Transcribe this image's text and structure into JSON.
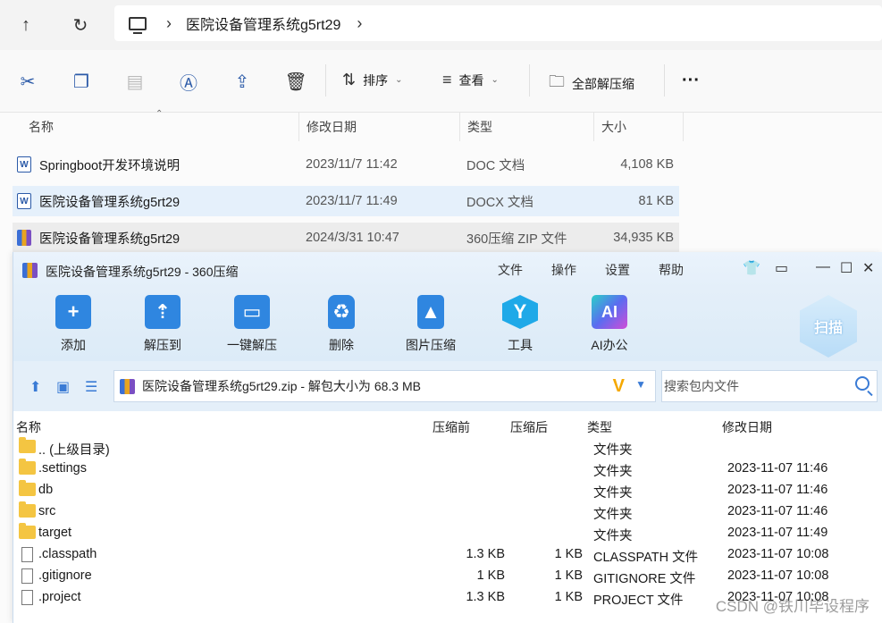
{
  "explorer": {
    "breadcrumb": "医院设备管理系统g5rt29",
    "toolbar": {
      "sort": "排序",
      "view": "查看",
      "extract_all": "全部解压缩"
    },
    "columns": {
      "name": "名称",
      "date": "修改日期",
      "type": "类型",
      "size": "大小"
    },
    "files": [
      {
        "name": "Springboot开发环境说明",
        "date": "2023/11/7 11:42",
        "type": "DOC 文档",
        "size": "4,108 KB",
        "icon": "word-icon"
      },
      {
        "name": "医院设备管理系统g5rt29",
        "date": "2023/11/7 11:49",
        "type": "DOCX 文档",
        "size": "81 KB",
        "icon": "word-icon"
      },
      {
        "name": "医院设备管理系统g5rt29",
        "date": "2024/3/31 10:47",
        "type": "360压缩 ZIP 文件",
        "size": "34,935 KB",
        "icon": "zip-icon"
      }
    ]
  },
  "zip": {
    "title": "医院设备管理系统g5rt29 - 360压缩",
    "menu": [
      "文件",
      "操作",
      "设置",
      "帮助"
    ],
    "tools": [
      "添加",
      "解压到",
      "一键解压",
      "删除",
      "图片压缩",
      "工具",
      "AI办公"
    ],
    "scan": "扫描",
    "path": "医院设备管理系统g5rt29.zip - 解包大小为 68.3 MB",
    "search_placeholder": "搜索包内文件",
    "columns": {
      "name": "名称",
      "compressed_before": "压缩前",
      "compressed_after": "压缩后",
      "type": "类型",
      "date": "修改日期"
    },
    "rows": [
      {
        "name": ".. (上级目录)",
        "before": "",
        "after": "",
        "type": "文件夹",
        "date": "",
        "kind": "folder"
      },
      {
        "name": ".settings",
        "before": "",
        "after": "",
        "type": "文件夹",
        "date": "2023-11-07 11:46",
        "kind": "folder"
      },
      {
        "name": "db",
        "before": "",
        "after": "",
        "type": "文件夹",
        "date": "2023-11-07 11:46",
        "kind": "folder"
      },
      {
        "name": "src",
        "before": "",
        "after": "",
        "type": "文件夹",
        "date": "2023-11-07 11:46",
        "kind": "folder"
      },
      {
        "name": "target",
        "before": "",
        "after": "",
        "type": "文件夹",
        "date": "2023-11-07 11:49",
        "kind": "folder"
      },
      {
        "name": ".classpath",
        "before": "1.3 KB",
        "after": "1 KB",
        "type": "CLASSPATH 文件",
        "date": "2023-11-07 10:08",
        "kind": "file"
      },
      {
        "name": ".gitignore",
        "before": "1 KB",
        "after": "1 KB",
        "type": "GITIGNORE 文件",
        "date": "2023-11-07 10:08",
        "kind": "file"
      },
      {
        "name": ".project",
        "before": "1.3 KB",
        "after": "1 KB",
        "type": "PROJECT 文件",
        "date": "2023-11-07 10:08",
        "kind": "file"
      }
    ]
  },
  "watermark": "CSDN @铁川毕设程序"
}
